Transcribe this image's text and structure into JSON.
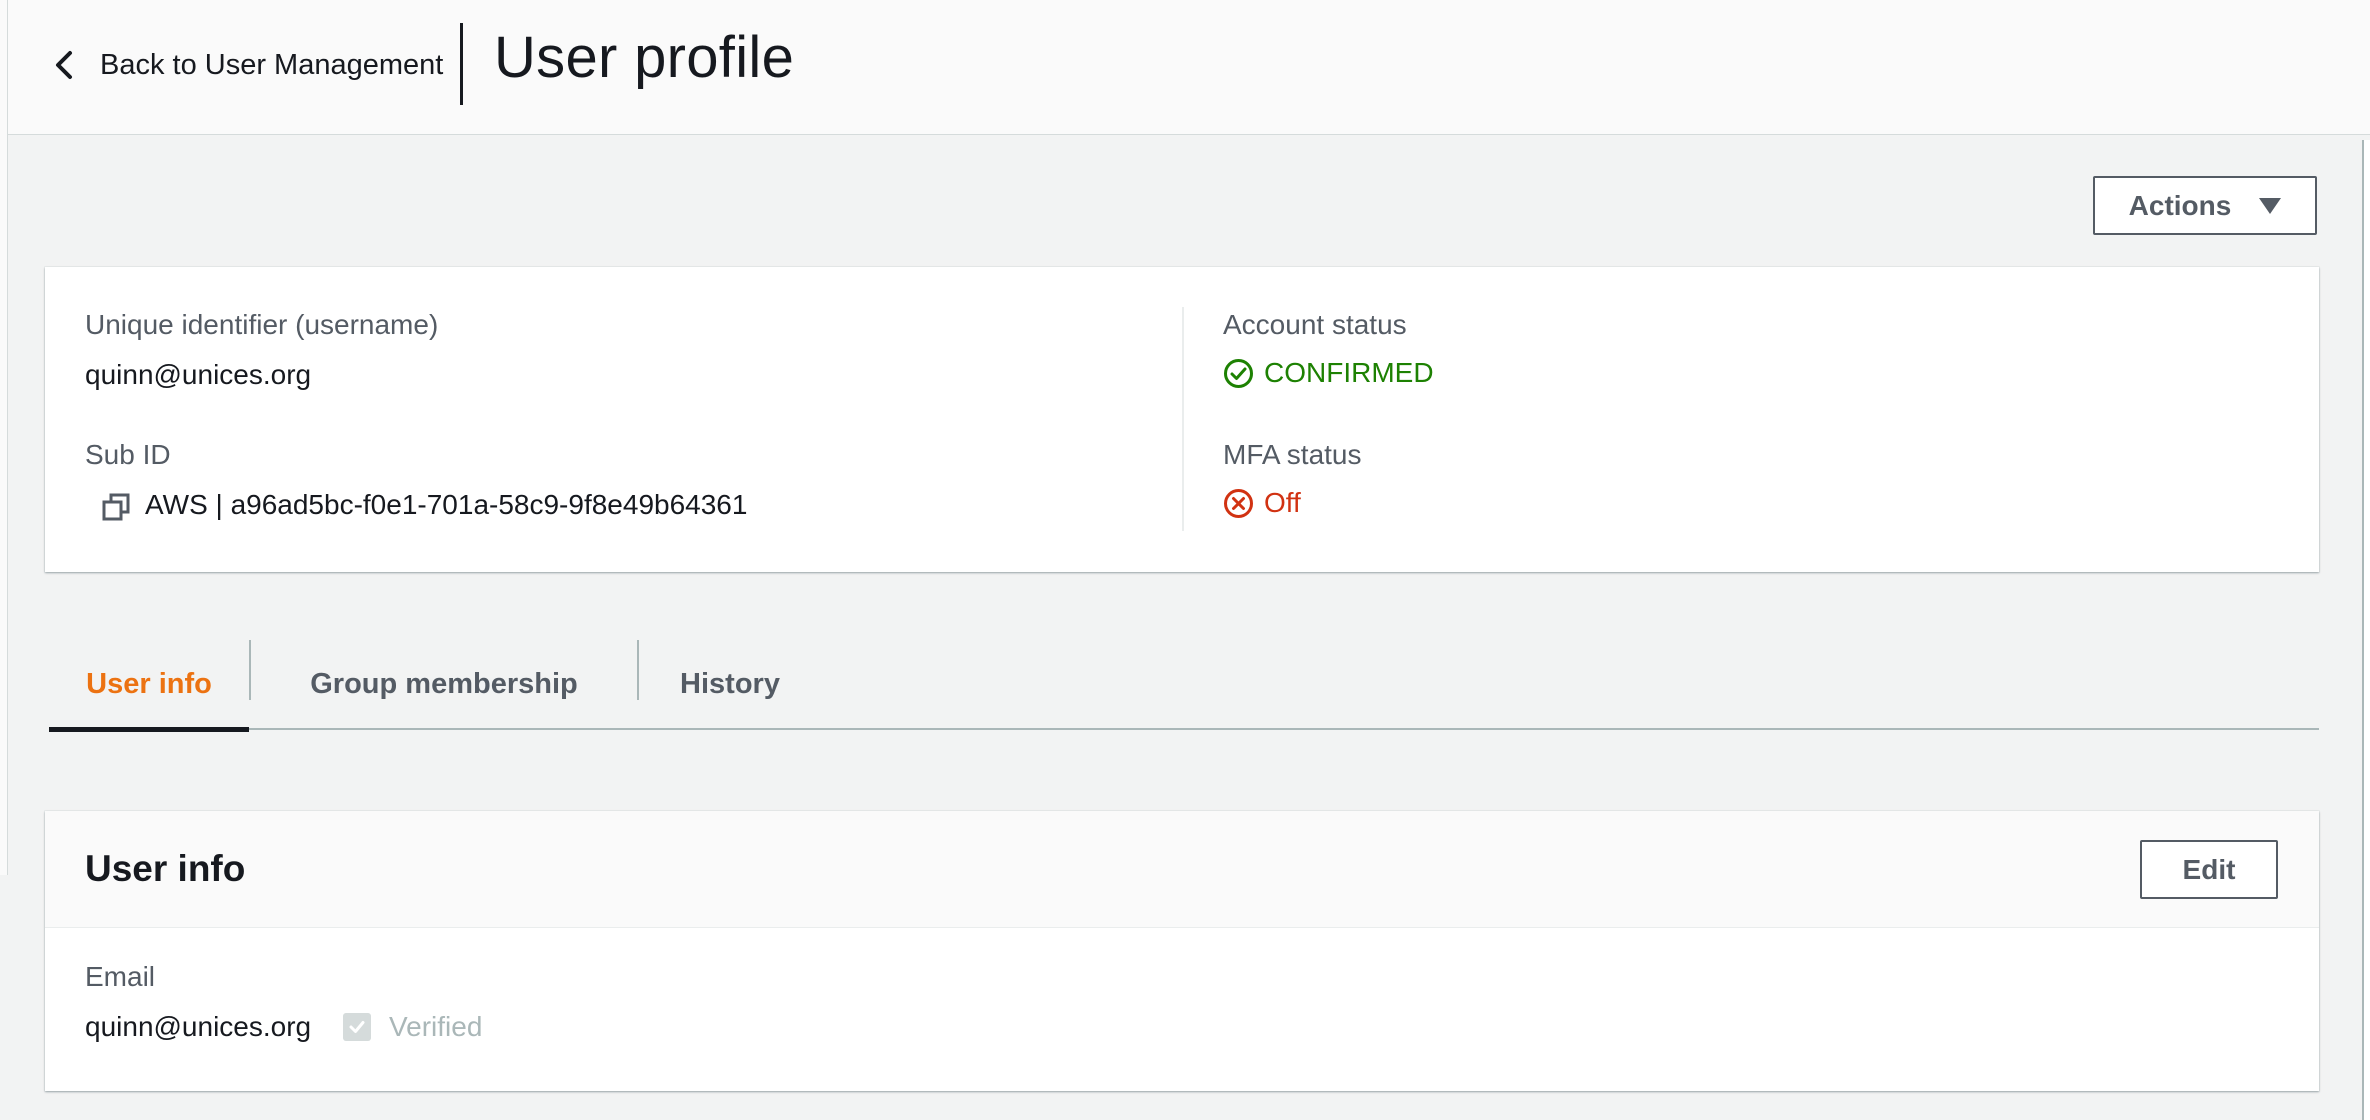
{
  "header": {
    "back_label": "Back to User Management",
    "title": "User profile"
  },
  "actions": {
    "label": "Actions"
  },
  "summary": {
    "username_label": "Unique identifier (username)",
    "username_value": "quinn@unices.org",
    "subid_label": "Sub ID",
    "subid_value": "AWS | a96ad5bc-f0e1-701a-58c9-9f8e49b64361",
    "account_status_label": "Account status",
    "account_status_value": "CONFIRMED",
    "mfa_status_label": "MFA status",
    "mfa_status_value": "Off"
  },
  "tabs": [
    {
      "label": "User info",
      "active": true
    },
    {
      "label": "Group membership",
      "active": false
    },
    {
      "label": "History",
      "active": false
    }
  ],
  "user_info": {
    "title": "User info",
    "edit_label": "Edit",
    "email_label": "Email",
    "email_value": "quinn@unices.org",
    "verified_label": "Verified",
    "verified_checked": true
  },
  "colors": {
    "accent": "#ec7211",
    "success": "#1d8102",
    "error": "#d13212",
    "text": "#16191f",
    "muted": "#545b64"
  },
  "icons": {
    "back": "chevron-left-icon",
    "actions_caret": "caret-down-icon",
    "copy": "copy-icon",
    "status_ok": "check-circle-icon",
    "status_off": "x-circle-icon",
    "checkbox": "checkbox-checked-icon"
  }
}
